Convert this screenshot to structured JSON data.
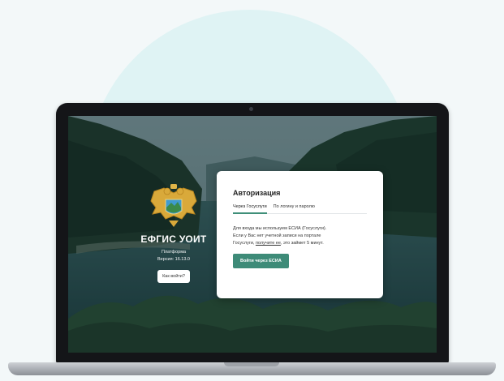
{
  "brand": {
    "title": "ЕФГИС УОИТ",
    "subtitle": "Платформа",
    "version": "Версия: 16.13.0",
    "how_button": "Как войти?"
  },
  "auth": {
    "title": "Авторизация",
    "tabs": [
      {
        "label": "Через Госуслуги",
        "active": true
      },
      {
        "label": "По логину и паролю",
        "active": false
      }
    ],
    "desc_line1": "Для входа мы используем ЕСИА (Госуслуги).",
    "desc_line2": "Если у Вас нет учетной записи на портале",
    "desc_line3_pre": "Госуслуги, ",
    "desc_link": "получите ее",
    "desc_line3_post": ", это займет 5 минут.",
    "button": "Войти через ЕСИА"
  },
  "colors": {
    "accent": "#3e8b78",
    "page_bg": "#f3f8f9",
    "circle": "#dff3f4"
  },
  "icons": {
    "emblem": "double-headed-eagle-emblem"
  }
}
